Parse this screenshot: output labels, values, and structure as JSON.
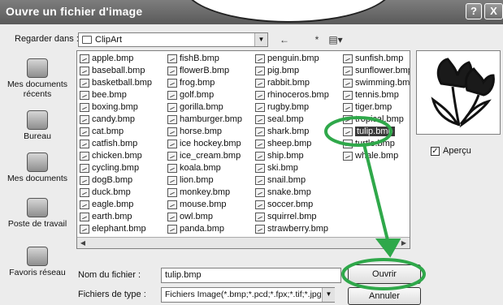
{
  "window": {
    "title": "Ouvre un fichier d'image",
    "help_label": "?",
    "close_label": "X"
  },
  "toolbar": {
    "look_in_label": "Regarder dans :",
    "look_in_value": "ClipArt",
    "back_icon": "←",
    "new_folder_icon": "*",
    "view_icon": "▤▾"
  },
  "places": [
    {
      "label": "Mes documents récents",
      "icon": "recent-documents-icon"
    },
    {
      "label": "Bureau",
      "icon": "desktop-icon"
    },
    {
      "label": "Mes documents",
      "icon": "my-documents-icon"
    },
    {
      "label": "Poste de travail",
      "icon": "computer-icon"
    },
    {
      "label": "Favoris réseau",
      "icon": "network-icon"
    }
  ],
  "files": {
    "col1": [
      "apple.bmp",
      "baseball.bmp",
      "basketball.bmp",
      "bee.bmp",
      "boxing.bmp",
      "candy.bmp",
      "cat.bmp",
      "catfish.bmp",
      "chicken.bmp",
      "cycling.bmp",
      "dogB.bmp",
      "duck.bmp",
      "eagle.bmp",
      "earth.bmp",
      "elephant.bmp"
    ],
    "col2": [
      "fishB.bmp",
      "flowerB.bmp",
      "frog.bmp",
      "golf.bmp",
      "gorilla.bmp",
      "hamburger.bmp",
      "horse.bmp",
      "ice hockey.bmp",
      "ice_cream.bmp",
      "koala.bmp",
      "lion.bmp",
      "monkey.bmp",
      "mouse.bmp",
      "owl.bmp",
      "panda.bmp"
    ],
    "col3": [
      "penguin.bmp",
      "pig.bmp",
      "rabbit.bmp",
      "rhinoceros.bmp",
      "rugby.bmp",
      "seal.bmp",
      "shark.bmp",
      "sheep.bmp",
      "ship.bmp",
      "ski.bmp",
      "snail.bmp",
      "snake.bmp",
      "soccer.bmp",
      "squirrel.bmp",
      "strawberry.bmp"
    ],
    "col4": [
      "sunfish.bmp",
      "sunflower.bmp",
      "swimming.bmp",
      "tennis.bmp",
      "tiger.bmp",
      "tropical.bmp",
      "tulip.bmp",
      "turtle.bmp",
      "whale.bmp"
    ],
    "selected": "tulip.bmp"
  },
  "preview": {
    "checkbox_label": "Aperçu",
    "checked": true,
    "image": "tulip-icon"
  },
  "bottom": {
    "filename_label": "Nom du fichier :",
    "filename_value": "tulip.bmp",
    "filetype_label": "Fichiers de type :",
    "filetype_value": "Fichiers Image(*.bmp;*.pcd;*.fpx;*.tif;*.jpg;*.pcx;",
    "open_button": "Ouvrir",
    "cancel_button": "Annuler"
  },
  "annotation": {
    "highlight_color": "#2fa84a"
  }
}
